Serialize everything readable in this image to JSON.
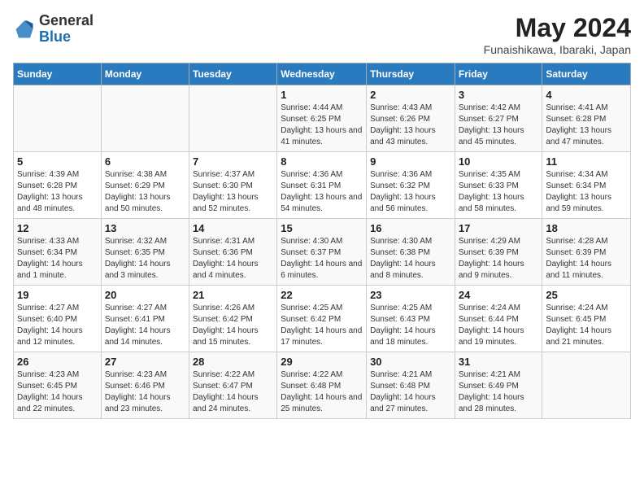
{
  "header": {
    "logo_general": "General",
    "logo_blue": "Blue",
    "month_year": "May 2024",
    "location": "Funaishikawa, Ibaraki, Japan"
  },
  "days_of_week": [
    "Sunday",
    "Monday",
    "Tuesday",
    "Wednesday",
    "Thursday",
    "Friday",
    "Saturday"
  ],
  "weeks": [
    [
      {
        "day": "",
        "info": ""
      },
      {
        "day": "",
        "info": ""
      },
      {
        "day": "",
        "info": ""
      },
      {
        "day": "1",
        "info": "Sunrise: 4:44 AM\nSunset: 6:25 PM\nDaylight: 13 hours and 41 minutes."
      },
      {
        "day": "2",
        "info": "Sunrise: 4:43 AM\nSunset: 6:26 PM\nDaylight: 13 hours and 43 minutes."
      },
      {
        "day": "3",
        "info": "Sunrise: 4:42 AM\nSunset: 6:27 PM\nDaylight: 13 hours and 45 minutes."
      },
      {
        "day": "4",
        "info": "Sunrise: 4:41 AM\nSunset: 6:28 PM\nDaylight: 13 hours and 47 minutes."
      }
    ],
    [
      {
        "day": "5",
        "info": "Sunrise: 4:39 AM\nSunset: 6:28 PM\nDaylight: 13 hours and 48 minutes."
      },
      {
        "day": "6",
        "info": "Sunrise: 4:38 AM\nSunset: 6:29 PM\nDaylight: 13 hours and 50 minutes."
      },
      {
        "day": "7",
        "info": "Sunrise: 4:37 AM\nSunset: 6:30 PM\nDaylight: 13 hours and 52 minutes."
      },
      {
        "day": "8",
        "info": "Sunrise: 4:36 AM\nSunset: 6:31 PM\nDaylight: 13 hours and 54 minutes."
      },
      {
        "day": "9",
        "info": "Sunrise: 4:36 AM\nSunset: 6:32 PM\nDaylight: 13 hours and 56 minutes."
      },
      {
        "day": "10",
        "info": "Sunrise: 4:35 AM\nSunset: 6:33 PM\nDaylight: 13 hours and 58 minutes."
      },
      {
        "day": "11",
        "info": "Sunrise: 4:34 AM\nSunset: 6:34 PM\nDaylight: 13 hours and 59 minutes."
      }
    ],
    [
      {
        "day": "12",
        "info": "Sunrise: 4:33 AM\nSunset: 6:34 PM\nDaylight: 14 hours and 1 minute."
      },
      {
        "day": "13",
        "info": "Sunrise: 4:32 AM\nSunset: 6:35 PM\nDaylight: 14 hours and 3 minutes."
      },
      {
        "day": "14",
        "info": "Sunrise: 4:31 AM\nSunset: 6:36 PM\nDaylight: 14 hours and 4 minutes."
      },
      {
        "day": "15",
        "info": "Sunrise: 4:30 AM\nSunset: 6:37 PM\nDaylight: 14 hours and 6 minutes."
      },
      {
        "day": "16",
        "info": "Sunrise: 4:30 AM\nSunset: 6:38 PM\nDaylight: 14 hours and 8 minutes."
      },
      {
        "day": "17",
        "info": "Sunrise: 4:29 AM\nSunset: 6:39 PM\nDaylight: 14 hours and 9 minutes."
      },
      {
        "day": "18",
        "info": "Sunrise: 4:28 AM\nSunset: 6:39 PM\nDaylight: 14 hours and 11 minutes."
      }
    ],
    [
      {
        "day": "19",
        "info": "Sunrise: 4:27 AM\nSunset: 6:40 PM\nDaylight: 14 hours and 12 minutes."
      },
      {
        "day": "20",
        "info": "Sunrise: 4:27 AM\nSunset: 6:41 PM\nDaylight: 14 hours and 14 minutes."
      },
      {
        "day": "21",
        "info": "Sunrise: 4:26 AM\nSunset: 6:42 PM\nDaylight: 14 hours and 15 minutes."
      },
      {
        "day": "22",
        "info": "Sunrise: 4:25 AM\nSunset: 6:42 PM\nDaylight: 14 hours and 17 minutes."
      },
      {
        "day": "23",
        "info": "Sunrise: 4:25 AM\nSunset: 6:43 PM\nDaylight: 14 hours and 18 minutes."
      },
      {
        "day": "24",
        "info": "Sunrise: 4:24 AM\nSunset: 6:44 PM\nDaylight: 14 hours and 19 minutes."
      },
      {
        "day": "25",
        "info": "Sunrise: 4:24 AM\nSunset: 6:45 PM\nDaylight: 14 hours and 21 minutes."
      }
    ],
    [
      {
        "day": "26",
        "info": "Sunrise: 4:23 AM\nSunset: 6:45 PM\nDaylight: 14 hours and 22 minutes."
      },
      {
        "day": "27",
        "info": "Sunrise: 4:23 AM\nSunset: 6:46 PM\nDaylight: 14 hours and 23 minutes."
      },
      {
        "day": "28",
        "info": "Sunrise: 4:22 AM\nSunset: 6:47 PM\nDaylight: 14 hours and 24 minutes."
      },
      {
        "day": "29",
        "info": "Sunrise: 4:22 AM\nSunset: 6:48 PM\nDaylight: 14 hours and 25 minutes."
      },
      {
        "day": "30",
        "info": "Sunrise: 4:21 AM\nSunset: 6:48 PM\nDaylight: 14 hours and 27 minutes."
      },
      {
        "day": "31",
        "info": "Sunrise: 4:21 AM\nSunset: 6:49 PM\nDaylight: 14 hours and 28 minutes."
      },
      {
        "day": "",
        "info": ""
      }
    ]
  ]
}
